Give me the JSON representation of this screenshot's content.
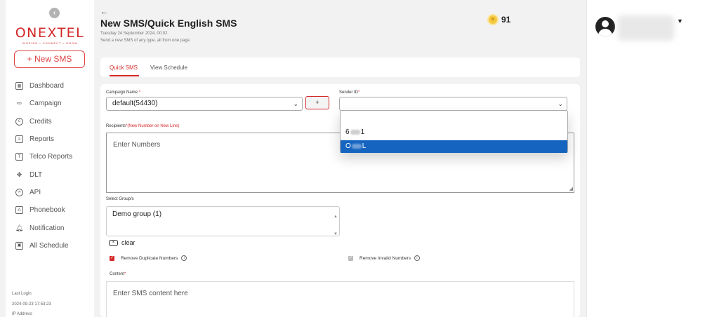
{
  "sidebar": {
    "collapse_icon": "‹",
    "logo": {
      "brand": "ONEXTEL",
      "tagline": "INSPIRE • CONNECT • GROW"
    },
    "new_sms_label": "+ New SMS",
    "items": [
      {
        "label": "Dashboard",
        "icon": "⊞"
      },
      {
        "label": "Campaign",
        "icon": "⇨"
      },
      {
        "label": "Credits",
        "icon": "©"
      },
      {
        "label": "Reports",
        "icon": "☰"
      },
      {
        "label": "Telco Reports",
        "icon": "T"
      },
      {
        "label": "DLT",
        "icon": "✥"
      },
      {
        "label": "API",
        "icon": "∞"
      },
      {
        "label": "Phonebook",
        "icon": "A"
      },
      {
        "label": "Notification",
        "icon": "🔔"
      },
      {
        "label": "All Schedule",
        "icon": "▣"
      }
    ],
    "last_login_label": "Last Login",
    "last_login_value": "2024-09-23 17:53:23",
    "ip_label": "IP Address"
  },
  "header": {
    "back_icon": "←",
    "title": "New SMS/Quick English SMS",
    "date": "Tuesday 24 September 2024, 00:02",
    "subtitle": "Send a new SMS of any type, all from one page.",
    "credits_value": "91"
  },
  "tabs": [
    {
      "label": "Quick SMS",
      "active": true
    },
    {
      "label": "View Schedule",
      "active": false
    }
  ],
  "form": {
    "campaign_label": "Campaign Name",
    "campaign_value": "default(54430)",
    "plus_label": "+",
    "sender_label": "Sender ID",
    "sender_value": "",
    "sender_options": [
      "6",
      "O"
    ],
    "sender_option_suffixes": [
      "1",
      "L"
    ],
    "recipients_label": "Recipients",
    "recipients_hint": "(New Number on New Line)",
    "recipients_placeholder": "Enter Numbers",
    "groups_label": "Select Group/s",
    "groups_options": [
      "Demo group (1)"
    ],
    "clear_label": "clear",
    "remove_duplicate_label": "Remove Duplicate Numbers",
    "remove_invalid_label": "Remove Invalid Numbers",
    "content_label": "Content",
    "content_placeholder": "Enter SMS content here",
    "required_mark": "*"
  },
  "colors": {
    "brand": "#d42828",
    "selected": "#1565c0"
  }
}
